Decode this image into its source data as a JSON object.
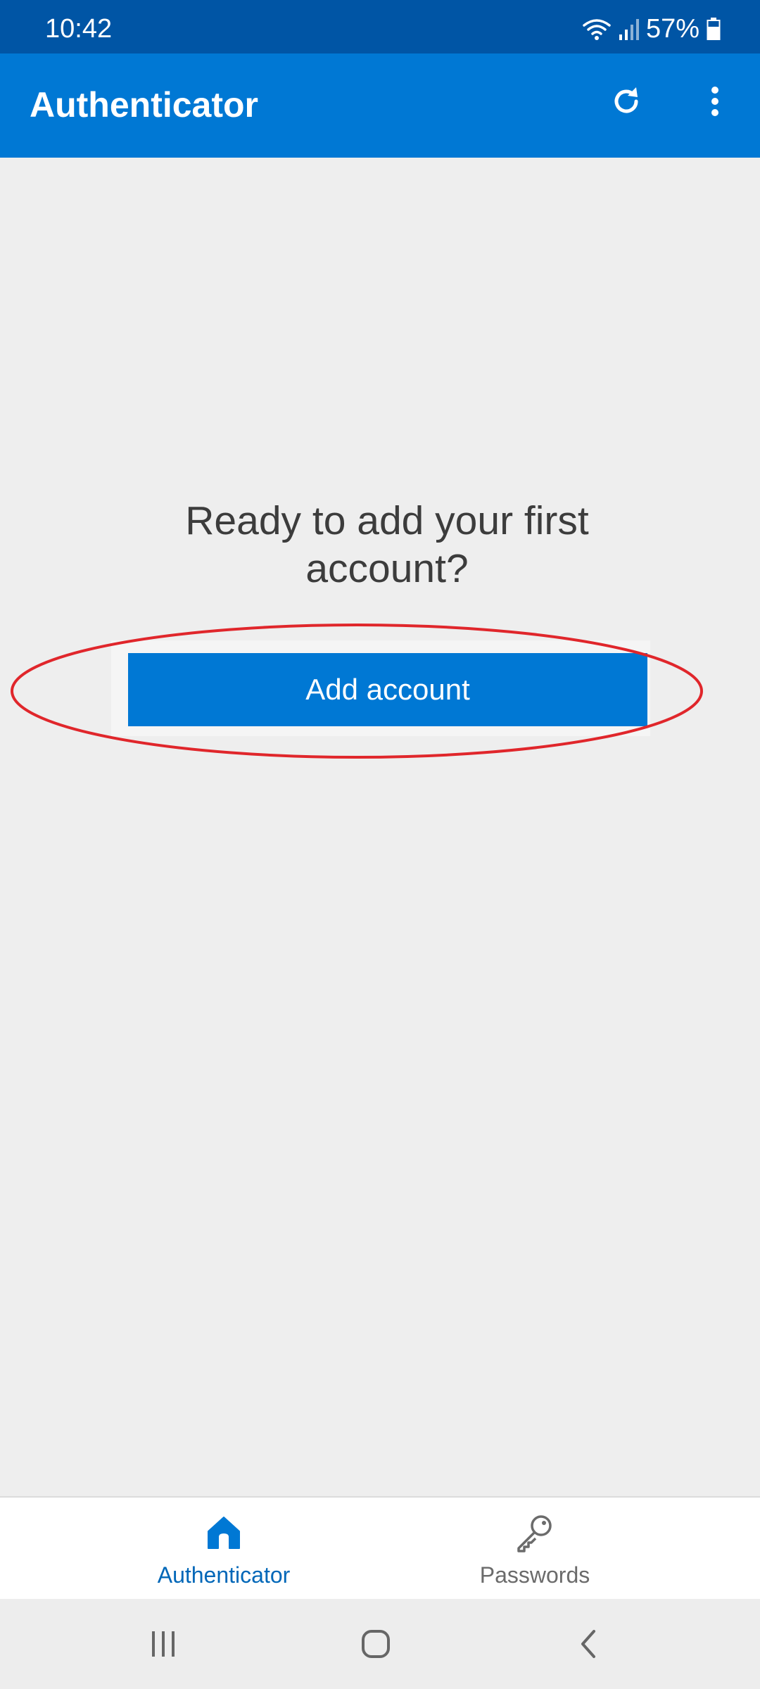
{
  "status_bar": {
    "time": "10:42",
    "battery": "57%",
    "icons": [
      "wifi-icon",
      "signal-icon",
      "battery-icon"
    ]
  },
  "app_bar": {
    "title": "Authenticator",
    "icons": [
      "refresh-icon",
      "more-vert-icon"
    ]
  },
  "main": {
    "prompt_line1": "Ready to add your first",
    "prompt_line2": "account?",
    "add_button_label": "Add account"
  },
  "bottom_nav": {
    "items": [
      {
        "label": "Authenticator",
        "icon": "home-icon",
        "active": true
      },
      {
        "label": "Passwords",
        "icon": "key-icon",
        "active": false
      }
    ]
  },
  "system_nav": {
    "icons": [
      "recents-icon",
      "home-button-icon",
      "back-icon"
    ]
  },
  "colors": {
    "status_bar": "#0055a5",
    "app_bar": "#0078d4",
    "background": "#eeeeee",
    "button": "#0078d4",
    "highlight": "#e0262b",
    "active_nav": "#0067b8",
    "inactive_nav": "#6b6b6b"
  }
}
